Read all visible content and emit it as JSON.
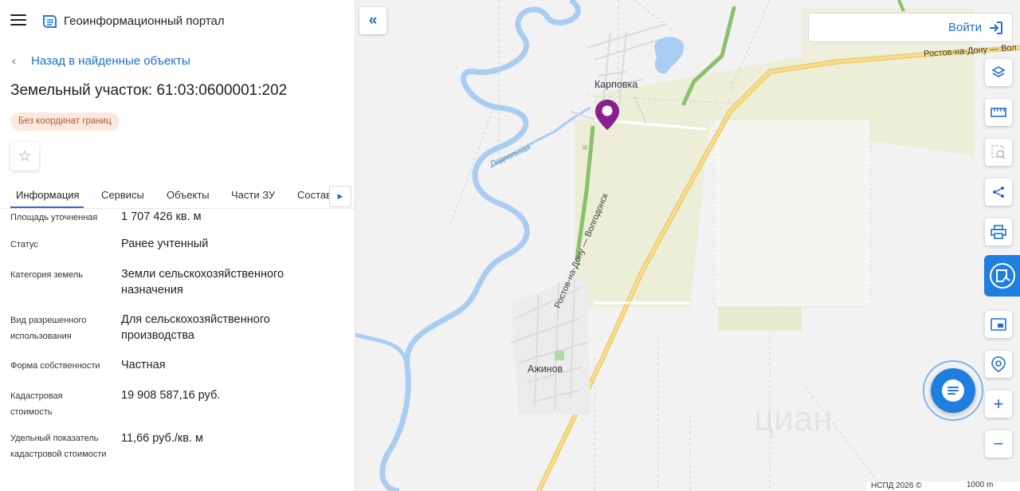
{
  "header": {
    "app_title": "Геоинформационный портал",
    "menu_icon": "hamburger-icon",
    "logo_icon": "portal-logo-icon"
  },
  "back_link": "Назад в найденные объекты",
  "parcel": {
    "title": "Земельный участок: 61:03:0600001:202",
    "badge": "Без координат границ"
  },
  "tabs": [
    {
      "label": "Информация",
      "active": true
    },
    {
      "label": "Сервисы"
    },
    {
      "label": "Объекты"
    },
    {
      "label": "Части ЗУ"
    },
    {
      "label": "Состав"
    }
  ],
  "attributes": [
    {
      "label": "Площадь уточненная",
      "value": "1 707 426 кв. м"
    },
    {
      "label": "Статус",
      "value": "Ранее учтенный"
    },
    {
      "label": "Категория земель",
      "value": "Земли сельскохозяйственного назначения"
    },
    {
      "label": "Вид разрешенного использования",
      "value": "Для сельскохозяйственного производства"
    },
    {
      "label": "Форма собственности",
      "value": "Частная"
    },
    {
      "label": "Кадастровая стоимость",
      "value": "19 908 587,16 руб."
    },
    {
      "label": "Удельный показатель кадастровой стоимости",
      "value": "11,66 руб./кв. м"
    }
  ],
  "map": {
    "login_label": "Войти",
    "labels": {
      "karpovka": "Карповка",
      "azhinov": "Ажинов",
      "podpolnaya": "Подпольная",
      "road_diag": "Ростов-на-Дону — Волгодонск",
      "road_top": "Ростов-на-Дону — Вол"
    },
    "scale_copyright": "НСПД 2026 ©",
    "scale_distance": "1000 m",
    "tools": [
      "layers-icon",
      "ruler-icon",
      "select-area-icon",
      "share-icon",
      "print-icon",
      "map-mode-icon",
      "minimap-icon",
      "locate-icon",
      "zoom-in-icon",
      "zoom-out-icon"
    ],
    "colors": {
      "accent": "#1f6fd1",
      "water": "#a9cdf2",
      "road": "#f3d77d",
      "field": "#ecedd6",
      "pin": "#8a1d8f"
    }
  }
}
